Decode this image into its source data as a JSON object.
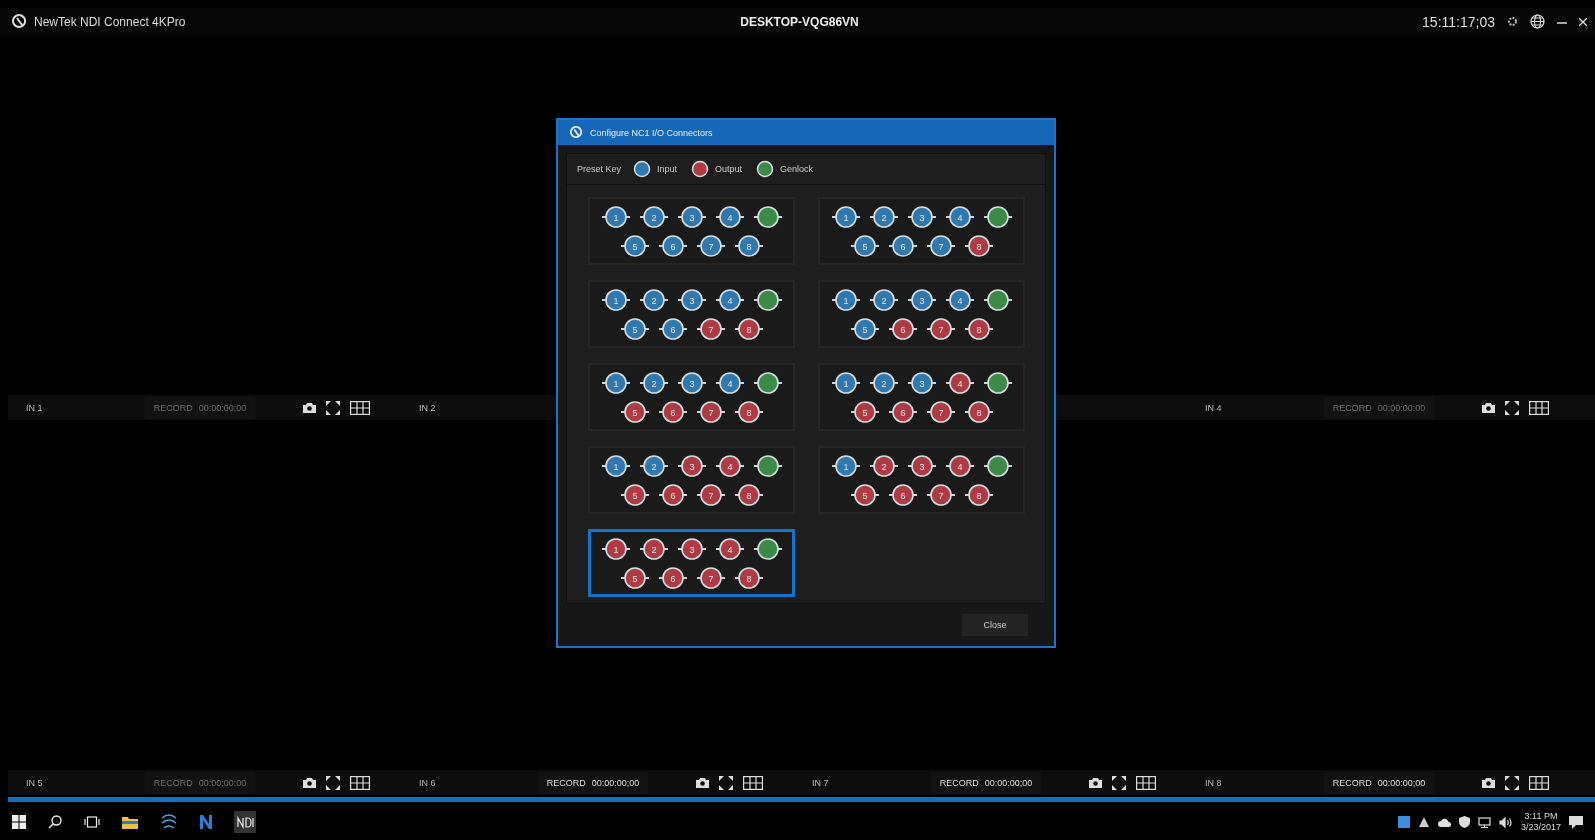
{
  "title_bar": {
    "app_name": "NewTek NDI Connect 4KPro",
    "machine": "DESKTOP-VQG86VN",
    "timecode": "15:11:17;03"
  },
  "monitor_rows": [
    {
      "channels": [
        {
          "kind": "full",
          "label": "IN 1",
          "record": "RECORD",
          "time": "00:00:00:00",
          "disabled": true
        },
        {
          "kind": "label_only",
          "label": "IN 2"
        },
        {
          "kind": "full",
          "label": "IN 4",
          "record": "RECORD",
          "time": "00:00:00:00",
          "disabled": true
        }
      ]
    },
    {
      "channels": [
        {
          "kind": "full",
          "label": "IN 5",
          "record": "RECORD",
          "time": "00:00:00:00",
          "disabled": true
        },
        {
          "kind": "full",
          "label": "IN 6",
          "record": "RECORD",
          "time": "00:00:00;00",
          "disabled": false
        },
        {
          "kind": "full",
          "label": "IN 7",
          "record": "RECORD",
          "time": "00:00:00;00",
          "disabled": false
        },
        {
          "kind": "full",
          "label": "IN 8",
          "record": "RECORD",
          "time": "00:00:00;00",
          "disabled": false
        }
      ]
    }
  ],
  "dialog": {
    "title": "Configure NC1 I/O Connectors",
    "key_label": "Preset Key",
    "key": [
      {
        "label": "Input",
        "kind": "input"
      },
      {
        "label": "Output",
        "kind": "output"
      },
      {
        "label": "Genlock",
        "kind": "genlock"
      }
    ],
    "presets": [
      {
        "selected": false,
        "connectors": [
          {
            "label": "1",
            "kind": "input"
          },
          {
            "label": "2",
            "kind": "input"
          },
          {
            "label": "3",
            "kind": "input"
          },
          {
            "label": "4",
            "kind": "input"
          },
          {
            "kind": "genlock"
          },
          {
            "label": "5",
            "kind": "input"
          },
          {
            "label": "6",
            "kind": "input"
          },
          {
            "label": "7",
            "kind": "input"
          },
          {
            "label": "8",
            "kind": "input"
          }
        ]
      },
      {
        "selected": false,
        "connectors": [
          {
            "label": "1",
            "kind": "input"
          },
          {
            "label": "2",
            "kind": "input"
          },
          {
            "label": "3",
            "kind": "input"
          },
          {
            "label": "4",
            "kind": "input"
          },
          {
            "kind": "genlock"
          },
          {
            "label": "5",
            "kind": "input"
          },
          {
            "label": "6",
            "kind": "input"
          },
          {
            "label": "7",
            "kind": "input"
          },
          {
            "label": "8",
            "kind": "output"
          }
        ]
      },
      {
        "selected": false,
        "connectors": [
          {
            "label": "1",
            "kind": "input"
          },
          {
            "label": "2",
            "kind": "input"
          },
          {
            "label": "3",
            "kind": "input"
          },
          {
            "label": "4",
            "kind": "input"
          },
          {
            "kind": "genlock"
          },
          {
            "label": "5",
            "kind": "input"
          },
          {
            "label": "6",
            "kind": "input"
          },
          {
            "label": "7",
            "kind": "output"
          },
          {
            "label": "8",
            "kind": "output"
          }
        ]
      },
      {
        "selected": false,
        "connectors": [
          {
            "label": "1",
            "kind": "input"
          },
          {
            "label": "2",
            "kind": "input"
          },
          {
            "label": "3",
            "kind": "input"
          },
          {
            "label": "4",
            "kind": "input"
          },
          {
            "kind": "genlock"
          },
          {
            "label": "5",
            "kind": "input"
          },
          {
            "label": "6",
            "kind": "output"
          },
          {
            "label": "7",
            "kind": "output"
          },
          {
            "label": "8",
            "kind": "output"
          }
        ]
      },
      {
        "selected": false,
        "connectors": [
          {
            "label": "1",
            "kind": "input"
          },
          {
            "label": "2",
            "kind": "input"
          },
          {
            "label": "3",
            "kind": "input"
          },
          {
            "label": "4",
            "kind": "input"
          },
          {
            "kind": "genlock"
          },
          {
            "label": "5",
            "kind": "output"
          },
          {
            "label": "6",
            "kind": "output"
          },
          {
            "label": "7",
            "kind": "output"
          },
          {
            "label": "8",
            "kind": "output"
          }
        ]
      },
      {
        "selected": false,
        "connectors": [
          {
            "label": "1",
            "kind": "input"
          },
          {
            "label": "2",
            "kind": "input"
          },
          {
            "label": "3",
            "kind": "input"
          },
          {
            "label": "4",
            "kind": "output"
          },
          {
            "kind": "genlock"
          },
          {
            "label": "5",
            "kind": "output"
          },
          {
            "label": "6",
            "kind": "output"
          },
          {
            "label": "7",
            "kind": "output"
          },
          {
            "label": "8",
            "kind": "output"
          }
        ]
      },
      {
        "selected": false,
        "connectors": [
          {
            "label": "1",
            "kind": "input"
          },
          {
            "label": "2",
            "kind": "input"
          },
          {
            "label": "3",
            "kind": "output"
          },
          {
            "label": "4",
            "kind": "output"
          },
          {
            "kind": "genlock"
          },
          {
            "label": "5",
            "kind": "output"
          },
          {
            "label": "6",
            "kind": "output"
          },
          {
            "label": "7",
            "kind": "output"
          },
          {
            "label": "8",
            "kind": "output"
          }
        ]
      },
      {
        "selected": false,
        "connectors": [
          {
            "label": "1",
            "kind": "input"
          },
          {
            "label": "2",
            "kind": "output"
          },
          {
            "label": "3",
            "kind": "output"
          },
          {
            "label": "4",
            "kind": "output"
          },
          {
            "kind": "genlock"
          },
          {
            "label": "5",
            "kind": "output"
          },
          {
            "label": "6",
            "kind": "output"
          },
          {
            "label": "7",
            "kind": "output"
          },
          {
            "label": "8",
            "kind": "output"
          }
        ]
      },
      {
        "selected": true,
        "connectors": [
          {
            "label": "1",
            "kind": "output"
          },
          {
            "label": "2",
            "kind": "output"
          },
          {
            "label": "3",
            "kind": "output"
          },
          {
            "label": "4",
            "kind": "output"
          },
          {
            "kind": "genlock"
          },
          {
            "label": "5",
            "kind": "output"
          },
          {
            "label": "6",
            "kind": "output"
          },
          {
            "label": "7",
            "kind": "output"
          },
          {
            "label": "8",
            "kind": "output"
          }
        ]
      }
    ],
    "close": "Close"
  },
  "taskbar": {
    "time": "3:11 PM",
    "date": "3/23/2017"
  }
}
